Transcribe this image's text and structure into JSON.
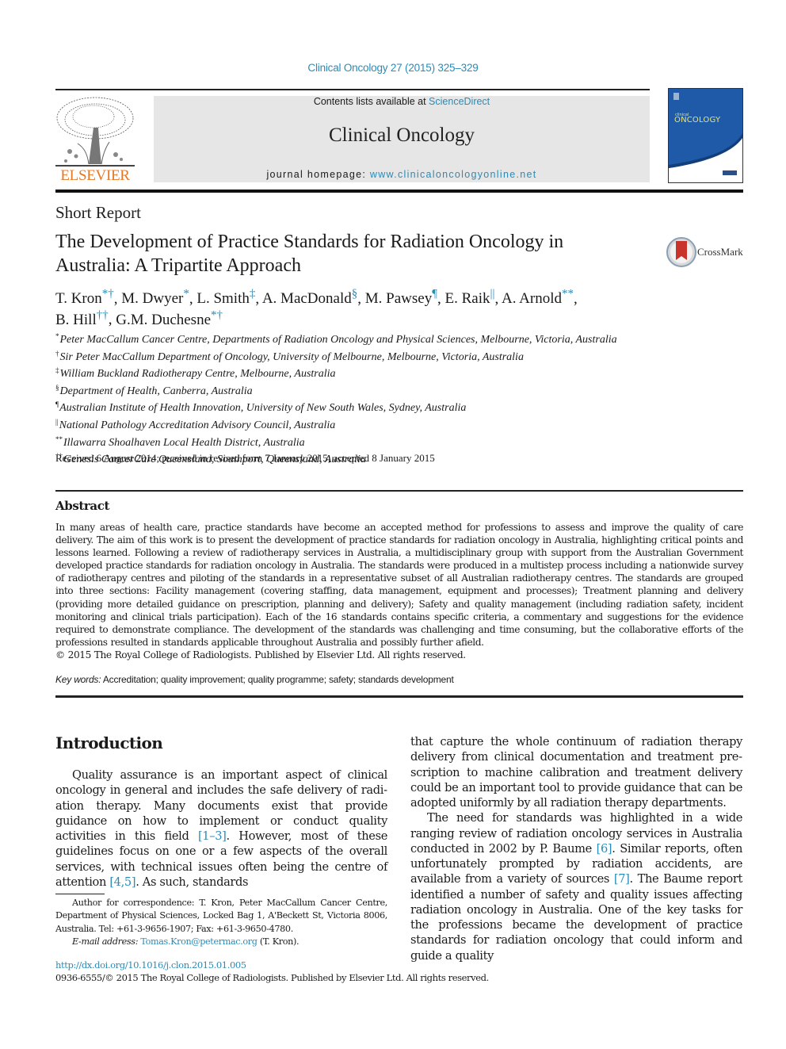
{
  "header": {
    "citation": "Clinical Oncology 27 (2015) 325–329",
    "contents_prefix": "Contents lists available at ",
    "contents_link": "ScienceDirect",
    "journal_title": "Clinical Oncology",
    "homepage_prefix": "journal homepage: ",
    "homepage_link": "www.clinicaloncologyonline.net",
    "publisher_logo_text": "ELSEVIER",
    "cover_small_text": "clinical",
    "cover_title": "ONCOLOGY",
    "colors": {
      "link": "#2a8bb7",
      "elsevier_orange": "#e87722",
      "cover_blue": "#1e5aa8",
      "masthead_bg": "#e6e6e6"
    }
  },
  "article": {
    "type": "Short Report",
    "title_line1": "The Development of Practice Standards for Radiation Oncology in",
    "title_line2": "Australia: A Tripartite Approach",
    "crossmark_label": "CrossMark",
    "authors": [
      {
        "name": "T. Kron",
        "marks": "*†",
        "sep": ", "
      },
      {
        "name": "M. Dwyer",
        "marks": "*",
        "sep": ", "
      },
      {
        "name": "L. Smith",
        "marks": "‡",
        "sep": ", "
      },
      {
        "name": "A. MacDonald",
        "marks": "§",
        "sep": ", "
      },
      {
        "name": "M. Pawsey",
        "marks": "¶",
        "sep": ", "
      },
      {
        "name": "E. Raik",
        "marks": "||",
        "sep": ", "
      },
      {
        "name": "A. Arnold",
        "marks": "**",
        "sep": ","
      },
      {
        "name": "B. Hill",
        "marks": "††",
        "sep": ", "
      },
      {
        "name": "G.M. Duchesne",
        "marks": "*†",
        "sep": ""
      }
    ],
    "affiliations": [
      {
        "mark": "*",
        "text": "Peter MacCallum Cancer Centre, Departments of Radiation Oncology and Physical Sciences, Melbourne, Victoria, Australia"
      },
      {
        "mark": "†",
        "text": "Sir Peter MacCallum Department of Oncology, University of Melbourne, Melbourne, Victoria, Australia"
      },
      {
        "mark": "‡",
        "text": "William Buckland Radiotherapy Centre, Melbourne, Australia"
      },
      {
        "mark": "§",
        "text": "Department of Health, Canberra, Australia"
      },
      {
        "mark": "¶",
        "text": "Australian Institute of Health Innovation, University of New South Wales, Sydney, Australia"
      },
      {
        "mark": "||",
        "text": "National Pathology Accreditation Advisory Council, Australia"
      },
      {
        "mark": "**",
        "text": "Illawarra Shoalhaven Local Health District, Australia"
      },
      {
        "mark": "††",
        "text": "Genesis CancerCare Queensland, Southport, Queensland, Australia"
      }
    ],
    "received": "Received 6 August 2014; received in revised form 7 January 2015; accepted 8 January 2015",
    "abstract_heading": "Abstract",
    "abstract_text": "In many areas of health care, practice standards have become an accepted method for professions to assess and improve the quality of care delivery. The aim of this work is to present the development of practice standards for radiation oncology in Australia, highlighting critical points and lessons learned. Following a review of radiotherapy services in Australia, a multidisciplinary group with support from the Australian Government developed practice standards for radiation oncology in Australia. The standards were produced in a multistep process including a nationwide survey of radiotherapy centres and piloting of the standards in a representative subset of all Australian radiotherapy centres. The standards are grouped into three sections: Facility management (covering staffing, data management, equipment and processes); Treatment planning and delivery (providing more detailed guidance on prescription, planning and delivery); Safety and quality management (including radiation safety, incident monitoring and clinical trials participation). Each of the 16 standards contains specific criteria, a commentary and suggestions for the evidence required to demonstrate compliance. The development of the standards was challenging and time consuming, but the collaborative efforts of the professions resulted in standards applicable throughout Australia and possibly further afield.",
    "abstract_copyright": "© 2015 The Royal College of Radiologists. Published by Elsevier Ltd. All rights reserved.",
    "keywords_label": "Key words:",
    "keywords": "Accreditation; quality improvement; quality programme; safety; standards development"
  },
  "body": {
    "intro_heading": "Introduction",
    "left_p1_a": "Quality assurance is an important aspect of clinical oncology in general and includes the safe delivery of radi­ation therapy. Many documents exist that provide guidance on how to implement or conduct quality activities in this field ",
    "left_p1_ref1": "[1–3]",
    "left_p1_b": ". However, most of these guidelines focus on one or a few aspects of the overall services, with technical issues often being the centre of attention ",
    "left_p1_ref2": "[4,5]",
    "left_p1_c": ". As such, standards",
    "right_p1": "that capture the whole continuum of radiation therapy delivery from clinical documentation and treatment pre­scription to machine calibration and treatment delivery could be an important tool to provide guidance that can be adopted uniformly by all radiation therapy departments.",
    "right_p2_a": "The need for standards was highlighted in a wide ranging review of radiation oncology services in Australia con­ducted in 2002 by P. Baume ",
    "right_p2_ref1": "[6]",
    "right_p2_b": ". Similar reports, often un­fortunately prompted by radiation accidents, are available from a variety of sources ",
    "right_p2_ref2": "[7]",
    "right_p2_c": ". The Baume report identified a number of safety and quality issues affecting radiation oncology in Australia. One of the key tasks for the pro­fessions became the development of practice standards for radiation oncology that could inform and guide a quality"
  },
  "footnote": {
    "correspondence": "Author for correspondence: T. Kron, Peter MacCallum Cancer Centre, Department of Physical Sciences, Locked Bag 1, A'Beckett St, Victoria 8006, Australia. Tel: +61-3-9656-1907; Fax: +61-3-9650-4780.",
    "email_label": "E-mail address: ",
    "email": "Tomas.Kron@petermac.org",
    "email_suffix": " (T. Kron)."
  },
  "footer": {
    "doi": "http://dx.doi.org/10.1016/j.clon.2015.01.005",
    "issn": "0936-6555/© 2015 The Royal College of Radiologists. Published by Elsevier Ltd. All rights reserved."
  }
}
